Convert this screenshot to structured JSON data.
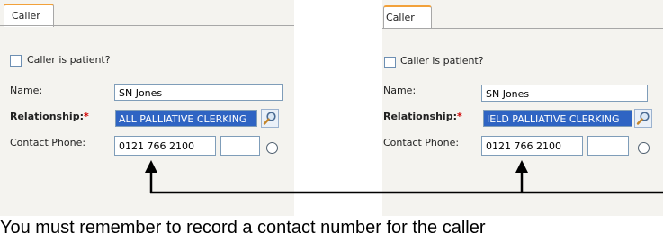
{
  "left": {
    "tab": "Caller",
    "caller_is_patient_label": "Caller is patient?",
    "name_label": "Name:",
    "name_value": "SN Jones",
    "relationship_label": "Relationship:",
    "required_mark": "*",
    "relationship_value": "ALL PALLIATIVE CLERKING",
    "contact_phone_label": "Contact Phone:",
    "phone_value": "0121 766 2100",
    "extension_value": ""
  },
  "right": {
    "tab": "Caller",
    "caller_is_patient_label": "Caller is patient?",
    "name_label": "Name:",
    "name_value": "SN Jones",
    "relationship_label": "Relationship:",
    "required_mark": "*",
    "relationship_value": "IELD PALLIATIVE CLERKING",
    "contact_phone_label": "Contact Phone:",
    "phone_value": "0121 766 2100",
    "extension_value": ""
  },
  "caption": "You must remember to record a contact number for the caller",
  "colors": {
    "tab_accent": "#f2a13a",
    "selection": "#2f64c3",
    "required": "#d00000"
  },
  "icons": {
    "lookup": "magnifier-icon",
    "option": "radio-icon"
  }
}
